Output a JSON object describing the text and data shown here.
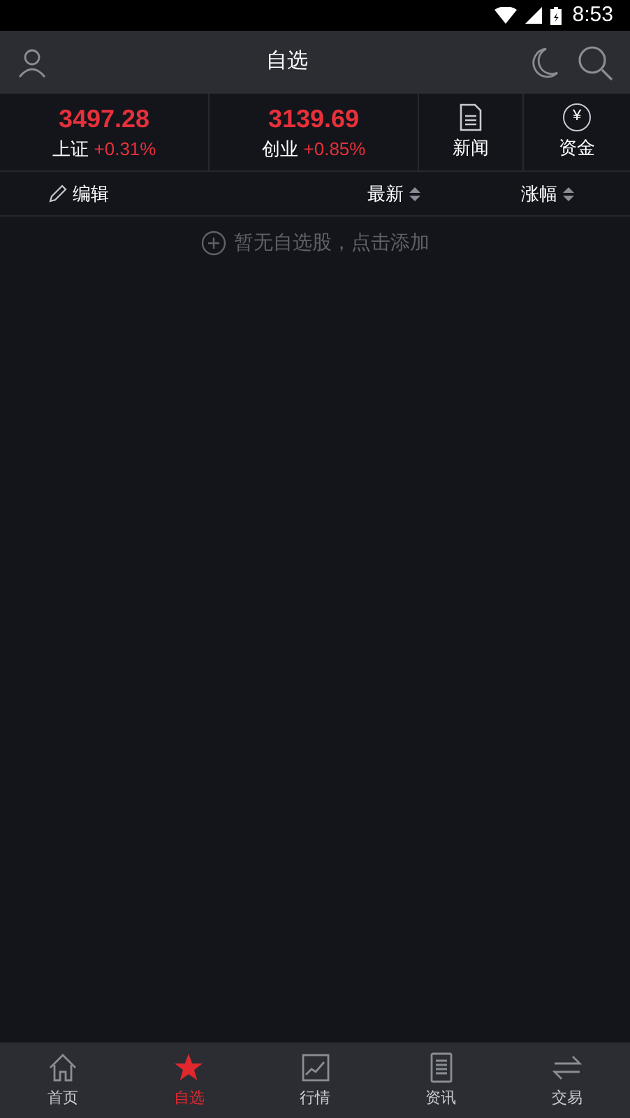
{
  "status_bar": {
    "time": "8:53"
  },
  "header": {
    "title": "自选"
  },
  "indices": [
    {
      "value": "3497.28",
      "name": "上证",
      "change": "+0.31%"
    },
    {
      "value": "3139.69",
      "name": "创业",
      "change": "+0.85%"
    }
  ],
  "shortcuts": [
    {
      "kind": "news",
      "label": "新闻"
    },
    {
      "kind": "funds",
      "label": "资金",
      "icon_text": "¥"
    }
  ],
  "columns": {
    "edit": "编辑",
    "latest": "最新",
    "change": "涨幅"
  },
  "empty_hint": "暂无自选股，点击添加",
  "tabs": [
    {
      "kind": "home",
      "label": "首页",
      "selected": false
    },
    {
      "kind": "star",
      "label": "自选",
      "selected": true
    },
    {
      "kind": "chart",
      "label": "行情",
      "selected": false
    },
    {
      "kind": "doc",
      "label": "资讯",
      "selected": false
    },
    {
      "kind": "trade",
      "label": "交易",
      "selected": false
    }
  ]
}
